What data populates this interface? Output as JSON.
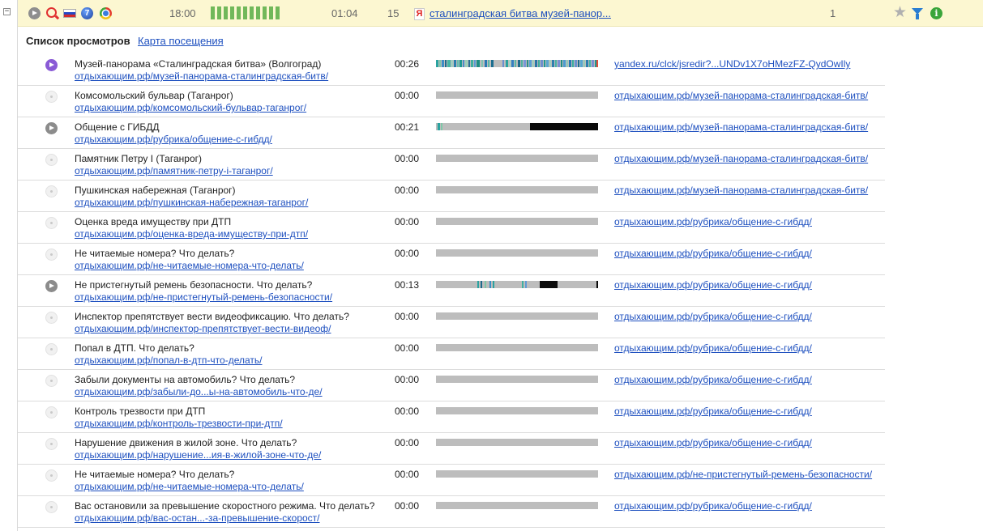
{
  "session": {
    "time": "18:00",
    "duration": "01:04",
    "page_count": "15",
    "search_query": "сталинградская битва музей-панор...",
    "visits": "1",
    "icons": [
      "play-icon",
      "search-engine-icon",
      "russia-flag-icon",
      "windows-icon",
      "chrome-icon",
      "yandex-icon",
      "star-icon",
      "filter-icon",
      "info-icon"
    ],
    "activity_bar_color": "#71b85a",
    "background_color": "#fcf7d1"
  },
  "section": {
    "title": "Список просмотров",
    "map_link": "Карта посещения"
  },
  "colors": {
    "link": "#1d4fbf",
    "current_page_icon": "#8a5bd6",
    "watched_icon": "#8c8c8c",
    "bar_idle": "#bdbdbd"
  },
  "rows": [
    {
      "state": "current",
      "title": "Музей-панорама «Сталинградская битва» (Волгоград)",
      "url": "отдыхающим.рф/музей-панорама-сталинградская-битв/",
      "time": "00:26",
      "activity": "dense",
      "referrer": "yandex.ru/clck/jsredir?...UNDv1X7oHMezFZ-QydOwIly"
    },
    {
      "state": "idle",
      "title": "Комсомольский бульвар (Таганрог)",
      "url": "отдыхающим.рф/комсомольский-бульвар-таганрог/",
      "time": "00:00",
      "activity": "none",
      "referrer": "отдыхающим.рф/музей-панорама-сталинградская-битв/"
    },
    {
      "state": "watched",
      "title": "Общение с ГИБДД",
      "url": "отдыхающим.рф/рубрика/общение-с-гибдд/",
      "time": "00:21",
      "activity": "tail-black",
      "referrer": "отдыхающим.рф/музей-панорама-сталинградская-битв/"
    },
    {
      "state": "idle",
      "title": "Памятник Петру I (Таганрог)",
      "url": "отдыхающим.рф/памятник-петру-i-таганрог/",
      "time": "00:00",
      "activity": "none",
      "referrer": "отдыхающим.рф/музей-панорама-сталинградская-битв/"
    },
    {
      "state": "idle",
      "title": "Пушкинская набережная (Таганрог)",
      "url": "отдыхающим.рф/пушкинская-набережная-таганрог/",
      "time": "00:00",
      "activity": "none",
      "referrer": "отдыхающим.рф/музей-панорама-сталинградская-битв/"
    },
    {
      "state": "idle",
      "title": "Оценка вреда имуществу при ДТП",
      "url": "отдыхающим.рф/оценка-вреда-имуществу-при-дтп/",
      "time": "00:00",
      "activity": "none",
      "referrer": "отдыхающим.рф/рубрика/общение-с-гибдд/"
    },
    {
      "state": "idle",
      "title": "Не читаемые номера? Что делать?",
      "url": "отдыхающим.рф/не-читаемые-номера-что-делать/",
      "time": "00:00",
      "activity": "none",
      "referrer": "отдыхающим.рф/рубрика/общение-с-гибдд/"
    },
    {
      "state": "watched",
      "title": "Не пристегнутый ремень безопасности. Что делать?",
      "url": "отдыхающим.рф/не-пристегнутый-ремень-безопасности/",
      "time": "00:13",
      "activity": "sparse",
      "referrer": "отдыхающим.рф/рубрика/общение-с-гибдд/"
    },
    {
      "state": "idle",
      "title": "Инспектор препятствует вести видеофиксацию. Что делать?",
      "url": "отдыхающим.рф/инспектор-препятствует-вести-видеоф/",
      "time": "00:00",
      "activity": "none",
      "referrer": "отдыхающим.рф/рубрика/общение-с-гибдд/"
    },
    {
      "state": "idle",
      "title": "Попал в ДТП. Что делать?",
      "url": "отдыхающим.рф/попал-в-дтп-что-делать/",
      "time": "00:00",
      "activity": "none",
      "referrer": "отдыхающим.рф/рубрика/общение-с-гибдд/"
    },
    {
      "state": "idle",
      "title": "Забыли документы на автомобиль? Что делать?",
      "url": "отдыхающим.рф/забыли-до...ы-на-автомобиль-что-де/",
      "time": "00:00",
      "activity": "none",
      "referrer": "отдыхающим.рф/рубрика/общение-с-гибдд/"
    },
    {
      "state": "idle",
      "title": "Контроль трезвости при ДТП",
      "url": "отдыхающим.рф/контроль-трезвости-при-дтп/",
      "time": "00:00",
      "activity": "none",
      "referrer": "отдыхающим.рф/рубрика/общение-с-гибдд/"
    },
    {
      "state": "idle",
      "title": "Нарушение движения в жилой зоне. Что делать?",
      "url": "отдыхающим.рф/нарушение...ия-в-жилой-зоне-что-де/",
      "time": "00:00",
      "activity": "none",
      "referrer": "отдыхающим.рф/рубрика/общение-с-гибдд/"
    },
    {
      "state": "idle",
      "title": "Не читаемые номера? Что делать?",
      "url": "отдыхающим.рф/не-читаемые-номера-что-делать/",
      "time": "00:00",
      "activity": "none",
      "referrer": "отдыхающим.рф/не-пристегнутый-ремень-безопасности/"
    },
    {
      "state": "idle",
      "title": "Вас остановили за превышение скоростного режима. Что делать?",
      "url": "отдыхающим.рф/вас-остан...-за-превышение-скорост/",
      "time": "00:00",
      "activity": "none",
      "referrer": "отдыхающим.рф/рубрика/общение-с-гибдд/"
    }
  ]
}
